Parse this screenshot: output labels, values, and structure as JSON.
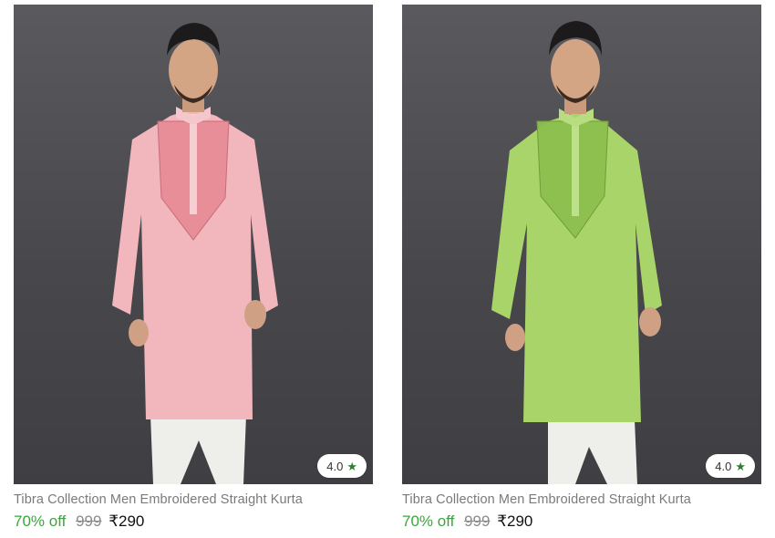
{
  "products": [
    {
      "title": "Tibra Collection Men Embroidered Straight Kurta",
      "discount": "70% off",
      "mrp": "999",
      "price": "₹290",
      "rating": "4.0",
      "rating_icon": "star-icon",
      "image_color": "#f2b7bd"
    },
    {
      "title": "Tibra Collection Men Embroidered Straight Kurta",
      "discount": "70% off",
      "mrp": "999",
      "price": "₹290",
      "rating": "4.0",
      "rating_icon": "star-icon",
      "image_color": "#a9d46a"
    }
  ]
}
